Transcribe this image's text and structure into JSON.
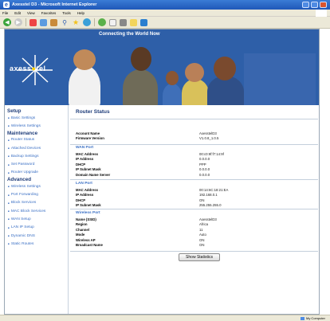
{
  "window": {
    "title": "Axesstel D3 - Microsoft Internet Explorer",
    "menu": [
      "File",
      "Edit",
      "View",
      "Favorites",
      "Tools",
      "Help"
    ]
  },
  "banner": {
    "slogan": "Connecting the World Now",
    "brand_prefix": "axess",
    "brand_suffix": "tel"
  },
  "sidebar": {
    "sections": [
      {
        "title": "Setup",
        "items": [
          "Basic Settings",
          "Wireless Settings"
        ]
      },
      {
        "title": "Maintenance",
        "items": [
          "Router Status",
          "Attached Devices",
          "Backup Settings",
          "Set Password",
          "Router Upgrade"
        ]
      },
      {
        "title": "Advanced",
        "items": [
          "Wireless Settings",
          "Port Forwarding",
          "Block Services",
          "MAC Block Services",
          "WAN Setup",
          "LAN IP Setup",
          "Dynamic DNS",
          "Static Routes"
        ]
      }
    ]
  },
  "main": {
    "heading": "Router Status",
    "groups": [
      {
        "title": "",
        "rows": [
          {
            "label": "Account Name",
            "value": "AxesstelD3"
          },
          {
            "label": "Firmware Version",
            "value": "V1.0.8_1.0.5"
          }
        ]
      },
      {
        "title": "WAN Port",
        "rows": [
          {
            "label": "MAC Address",
            "value": "00:c0:9f:f7:14:9f"
          },
          {
            "label": "IP Address",
            "value": "0.0.0.0"
          },
          {
            "label": "DHCP",
            "value": "PPP"
          },
          {
            "label": "IP Subnet Mask",
            "value": "0.0.0.0"
          },
          {
            "label": "Domain Name Server",
            "value": "0.0.0.0"
          }
        ]
      },
      {
        "title": "LAN Port",
        "rows": [
          {
            "label": "MAC Address",
            "value": "00:14:6C:18:21:EA"
          },
          {
            "label": "IP Address",
            "value": "192.168.0.1"
          },
          {
            "label": "DHCP",
            "value": "ON"
          },
          {
            "label": "IP Subnet Mask",
            "value": "255.255.255.0"
          }
        ]
      },
      {
        "title": "Wireless Port",
        "rows": [
          {
            "label": "Name (SSID)",
            "value": "AxesstelD3"
          },
          {
            "label": "Region",
            "value": "Africa"
          },
          {
            "label": "Channel",
            "value": "11"
          },
          {
            "label": "Mode",
            "value": "Auto"
          },
          {
            "label": "Wireless AP",
            "value": "ON"
          },
          {
            "label": "Broadcast Name",
            "value": "ON"
          }
        ]
      }
    ],
    "show_stats_label": "Show Statistics"
  },
  "statusbar": {
    "zone": "My Computer"
  }
}
